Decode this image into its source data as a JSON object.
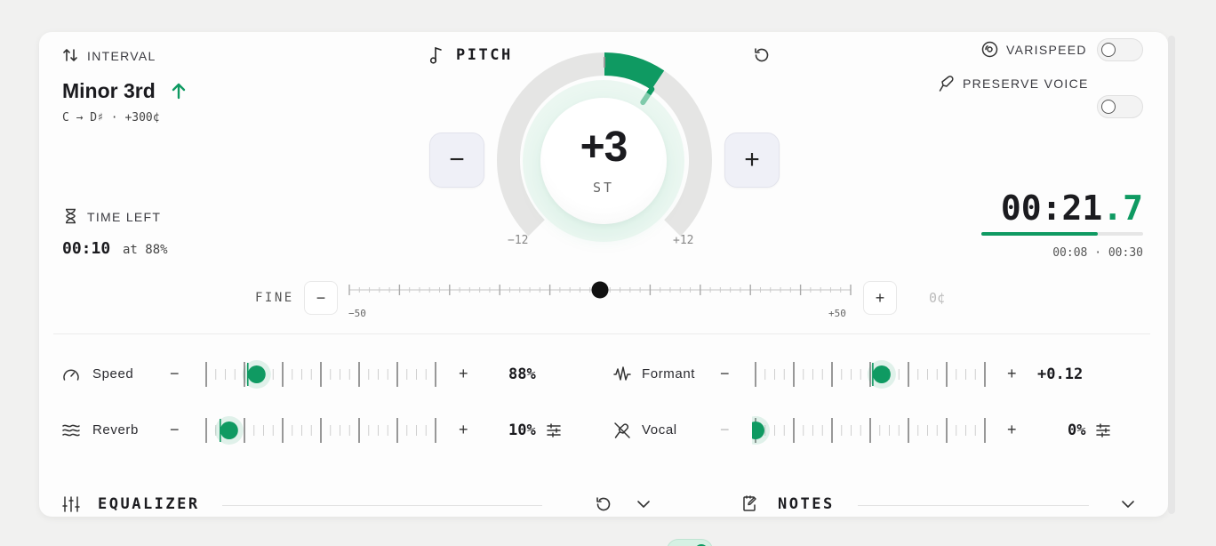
{
  "interval": {
    "label": "INTERVAL",
    "name": "Minor 3rd",
    "detail": "C → D♯ · +300¢"
  },
  "time_left": {
    "label": "TIME LEFT",
    "value": "00:10",
    "suffix": "at 88%"
  },
  "pitch": {
    "title": "PITCH",
    "value": "+3",
    "unit": "ST",
    "min_label": "−12",
    "max_label": "+12",
    "minus": "−",
    "plus": "+",
    "semitones": 3,
    "range": [
      -12,
      12
    ]
  },
  "varispeed": {
    "label": "VARISPEED",
    "on": false
  },
  "preserve_voice": {
    "label": "PRESERVE VOICE",
    "on": false
  },
  "timer": {
    "main": "00:21",
    "decimal": ".7",
    "elapsed": "00:08",
    "sep": "·",
    "total": "00:30",
    "progress": 0.72
  },
  "fine": {
    "label": "FINE",
    "min_label": "−50",
    "max_label": "+50",
    "value": "0¢",
    "minus": "−",
    "plus": "+",
    "position": 0.5
  },
  "params": {
    "speed": {
      "label": "Speed",
      "value": "88%",
      "position": 0.22
    },
    "reverb": {
      "label": "Reverb",
      "value": "10%",
      "position": 0.1
    },
    "formant": {
      "label": "Formant",
      "value": "+0.12",
      "position": 0.55
    },
    "vocal": {
      "label": "Vocal",
      "value": "0%",
      "position": 0.0
    },
    "minus": "−",
    "plus": "+"
  },
  "equalizer": {
    "label": "EQUALIZER",
    "on": true
  },
  "notes": {
    "label": "NOTES"
  },
  "colors": {
    "accent": "#0f9a62",
    "accent_light": "#d6f1e4",
    "track": "#e6e6e6"
  },
  "icons": [
    "swap-vertical-icon",
    "music-note-icon",
    "reset-icon",
    "disc-icon",
    "microphone-icon",
    "hourglass-icon",
    "gauge-icon",
    "waves-icon",
    "waveform-icon",
    "mic-off-icon",
    "sliders-icon",
    "chevron-down-icon",
    "notes-edit-icon"
  ]
}
